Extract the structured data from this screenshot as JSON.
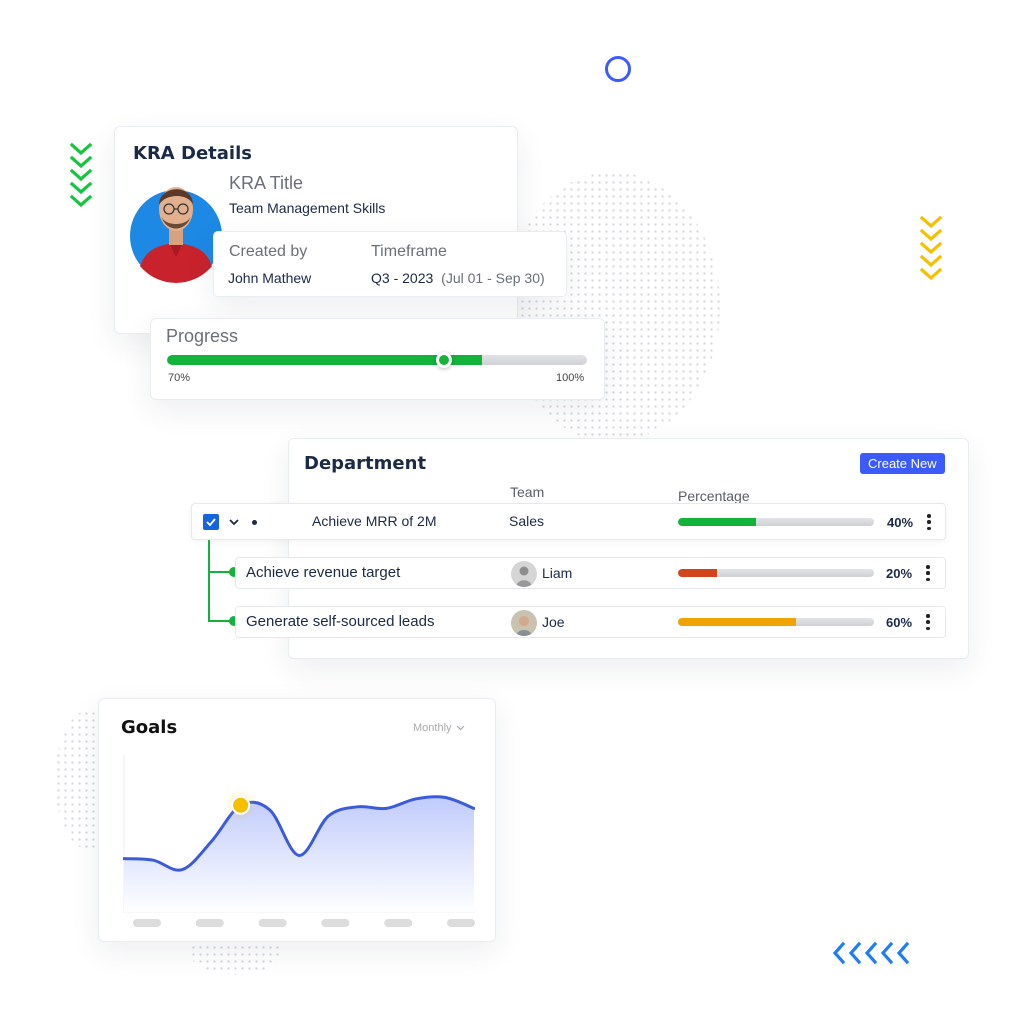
{
  "kra_card": {
    "heading": "KRA Details",
    "kra_title_label": "KRA Title",
    "kra_title_value": "Team Management Skills",
    "created_by_label": "Created by",
    "created_by_value": "John Mathew",
    "timeframe_label": "Timeframe",
    "timeframe_quarter": "Q3 - 2023",
    "timeframe_range": "(Jul 01 - Sep 30)",
    "avatar_bg_color": "#1e88e5"
  },
  "progress_card": {
    "label": "Progress",
    "min_label": "70%",
    "max_label": "100%",
    "fill_fraction": 0.75,
    "handle_fraction": 0.66,
    "fill_color": "#13b33b"
  },
  "department_card": {
    "heading": "Department",
    "create_button": "Create New",
    "accent_color": "#3b5bfd",
    "columns": {
      "team": "Team",
      "percentage": "Percentage"
    },
    "parent_row": {
      "title": "Achieve MRR of 2M",
      "team": "Sales",
      "percent_label": "40%",
      "percent": 40,
      "color": "#13b33b",
      "checked": true
    },
    "child_rows": [
      {
        "title": "Achieve revenue target",
        "owner": "Liam",
        "percent_label": "20%",
        "percent": 20,
        "color": "#d2441c"
      },
      {
        "title": "Generate self-sourced leads",
        "owner": "Joe",
        "percent_label": "60%",
        "percent": 60,
        "color": "#eea300"
      }
    ],
    "tree_line_color": "#13b33b"
  },
  "goals_card": {
    "heading": "Goals",
    "period_select": "Monthly",
    "chart_data": {
      "type": "area",
      "title": "Goals",
      "xlabel": "",
      "ylabel": "",
      "x_tick_labels": [
        "",
        "",
        "",
        "",
        "",
        ""
      ],
      "x": [
        0,
        0.5,
        1,
        1.5,
        2,
        2.5,
        3,
        3.5,
        4,
        4.5,
        5,
        5.5,
        6
      ],
      "values": [
        34,
        33,
        27,
        45,
        68,
        65,
        36,
        61,
        67,
        66,
        72,
        73,
        66
      ],
      "ylim": [
        0,
        100
      ],
      "highlight_index": 4,
      "line_color": "#3b5bdb",
      "highlight_color": "#f5c000",
      "grid": false,
      "legend": "none"
    }
  },
  "decorations": {
    "green_chevrons": 5,
    "yellow_chevrons": 5,
    "blue_chevrons": 5,
    "green": "#17c43f",
    "yellow": "#f5c000",
    "blue": "#1e7ff0",
    "ring_color": "#3b5bfd"
  }
}
